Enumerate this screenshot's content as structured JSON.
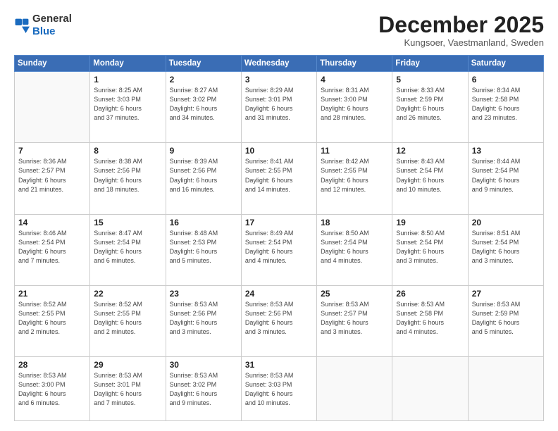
{
  "logo": {
    "general": "General",
    "blue": "Blue"
  },
  "header": {
    "month": "December 2025",
    "location": "Kungsoer, Vaestmanland, Sweden"
  },
  "days_of_week": [
    "Sunday",
    "Monday",
    "Tuesday",
    "Wednesday",
    "Thursday",
    "Friday",
    "Saturday"
  ],
  "weeks": [
    [
      {
        "num": "",
        "info": ""
      },
      {
        "num": "1",
        "info": "Sunrise: 8:25 AM\nSunset: 3:03 PM\nDaylight: 6 hours\nand 37 minutes."
      },
      {
        "num": "2",
        "info": "Sunrise: 8:27 AM\nSunset: 3:02 PM\nDaylight: 6 hours\nand 34 minutes."
      },
      {
        "num": "3",
        "info": "Sunrise: 8:29 AM\nSunset: 3:01 PM\nDaylight: 6 hours\nand 31 minutes."
      },
      {
        "num": "4",
        "info": "Sunrise: 8:31 AM\nSunset: 3:00 PM\nDaylight: 6 hours\nand 28 minutes."
      },
      {
        "num": "5",
        "info": "Sunrise: 8:33 AM\nSunset: 2:59 PM\nDaylight: 6 hours\nand 26 minutes."
      },
      {
        "num": "6",
        "info": "Sunrise: 8:34 AM\nSunset: 2:58 PM\nDaylight: 6 hours\nand 23 minutes."
      }
    ],
    [
      {
        "num": "7",
        "info": "Sunrise: 8:36 AM\nSunset: 2:57 PM\nDaylight: 6 hours\nand 21 minutes."
      },
      {
        "num": "8",
        "info": "Sunrise: 8:38 AM\nSunset: 2:56 PM\nDaylight: 6 hours\nand 18 minutes."
      },
      {
        "num": "9",
        "info": "Sunrise: 8:39 AM\nSunset: 2:56 PM\nDaylight: 6 hours\nand 16 minutes."
      },
      {
        "num": "10",
        "info": "Sunrise: 8:41 AM\nSunset: 2:55 PM\nDaylight: 6 hours\nand 14 minutes."
      },
      {
        "num": "11",
        "info": "Sunrise: 8:42 AM\nSunset: 2:55 PM\nDaylight: 6 hours\nand 12 minutes."
      },
      {
        "num": "12",
        "info": "Sunrise: 8:43 AM\nSunset: 2:54 PM\nDaylight: 6 hours\nand 10 minutes."
      },
      {
        "num": "13",
        "info": "Sunrise: 8:44 AM\nSunset: 2:54 PM\nDaylight: 6 hours\nand 9 minutes."
      }
    ],
    [
      {
        "num": "14",
        "info": "Sunrise: 8:46 AM\nSunset: 2:54 PM\nDaylight: 6 hours\nand 7 minutes."
      },
      {
        "num": "15",
        "info": "Sunrise: 8:47 AM\nSunset: 2:54 PM\nDaylight: 6 hours\nand 6 minutes."
      },
      {
        "num": "16",
        "info": "Sunrise: 8:48 AM\nSunset: 2:53 PM\nDaylight: 6 hours\nand 5 minutes."
      },
      {
        "num": "17",
        "info": "Sunrise: 8:49 AM\nSunset: 2:54 PM\nDaylight: 6 hours\nand 4 minutes."
      },
      {
        "num": "18",
        "info": "Sunrise: 8:50 AM\nSunset: 2:54 PM\nDaylight: 6 hours\nand 4 minutes."
      },
      {
        "num": "19",
        "info": "Sunrise: 8:50 AM\nSunset: 2:54 PM\nDaylight: 6 hours\nand 3 minutes."
      },
      {
        "num": "20",
        "info": "Sunrise: 8:51 AM\nSunset: 2:54 PM\nDaylight: 6 hours\nand 3 minutes."
      }
    ],
    [
      {
        "num": "21",
        "info": "Sunrise: 8:52 AM\nSunset: 2:55 PM\nDaylight: 6 hours\nand 2 minutes."
      },
      {
        "num": "22",
        "info": "Sunrise: 8:52 AM\nSunset: 2:55 PM\nDaylight: 6 hours\nand 2 minutes."
      },
      {
        "num": "23",
        "info": "Sunrise: 8:53 AM\nSunset: 2:56 PM\nDaylight: 6 hours\nand 3 minutes."
      },
      {
        "num": "24",
        "info": "Sunrise: 8:53 AM\nSunset: 2:56 PM\nDaylight: 6 hours\nand 3 minutes."
      },
      {
        "num": "25",
        "info": "Sunrise: 8:53 AM\nSunset: 2:57 PM\nDaylight: 6 hours\nand 3 minutes."
      },
      {
        "num": "26",
        "info": "Sunrise: 8:53 AM\nSunset: 2:58 PM\nDaylight: 6 hours\nand 4 minutes."
      },
      {
        "num": "27",
        "info": "Sunrise: 8:53 AM\nSunset: 2:59 PM\nDaylight: 6 hours\nand 5 minutes."
      }
    ],
    [
      {
        "num": "28",
        "info": "Sunrise: 8:53 AM\nSunset: 3:00 PM\nDaylight: 6 hours\nand 6 minutes."
      },
      {
        "num": "29",
        "info": "Sunrise: 8:53 AM\nSunset: 3:01 PM\nDaylight: 6 hours\nand 7 minutes."
      },
      {
        "num": "30",
        "info": "Sunrise: 8:53 AM\nSunset: 3:02 PM\nDaylight: 6 hours\nand 9 minutes."
      },
      {
        "num": "31",
        "info": "Sunrise: 8:53 AM\nSunset: 3:03 PM\nDaylight: 6 hours\nand 10 minutes."
      },
      {
        "num": "",
        "info": ""
      },
      {
        "num": "",
        "info": ""
      },
      {
        "num": "",
        "info": ""
      }
    ]
  ]
}
